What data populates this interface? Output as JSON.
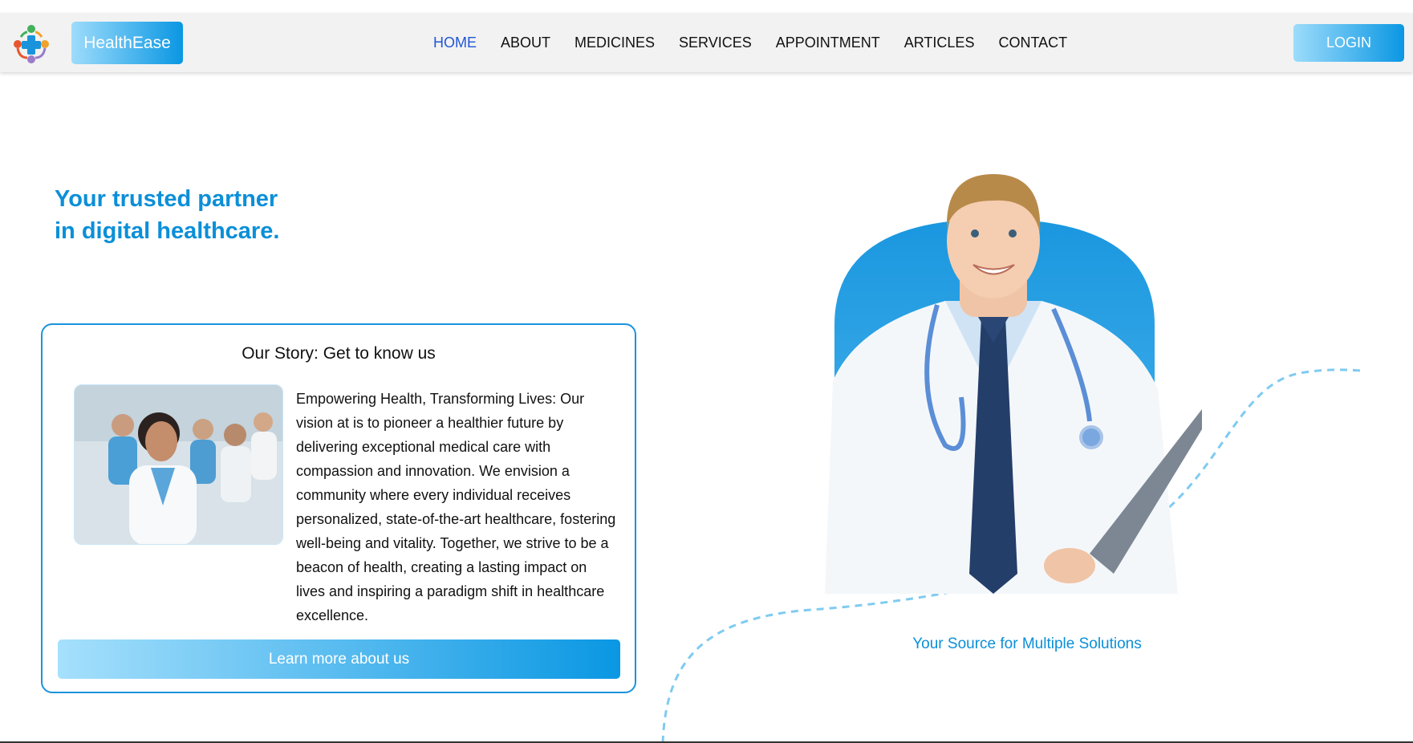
{
  "brand": {
    "name": "HealthEase",
    "logo_icon": "medical-cross-people-logo"
  },
  "nav": {
    "items": [
      {
        "label": "HOME",
        "active": true
      },
      {
        "label": "ABOUT",
        "active": false
      },
      {
        "label": "MEDICINES",
        "active": false
      },
      {
        "label": "SERVICES",
        "active": false
      },
      {
        "label": "APPOINTMENT",
        "active": false
      },
      {
        "label": "ARTICLES",
        "active": false
      },
      {
        "label": "CONTACT",
        "active": false
      }
    ],
    "login_label": "LOGIN"
  },
  "hero": {
    "line1": "Your trusted partner",
    "line2": "in digital healthcare.",
    "tagline": "Your Source for Multiple Solutions"
  },
  "story": {
    "heading": "Our Story: Get to know us",
    "body": "Empowering Health, Transforming Lives: Our vision at is to pioneer a healthier future by delivering exceptional medical care with compassion and innovation. We envision a community where every individual receives personalized, state-of-the-art healthcare, fostering well-being and vitality. Together, we strive to be a beacon of health, creating a lasting impact on lives and inspiring a paradigm shift in healthcare excellence.",
    "button_label": "Learn more about us"
  },
  "colors": {
    "accent": "#0b8fd8",
    "active_nav": "#2057d6",
    "gradient_start": "#9ddcfb",
    "gradient_end": "#0a97e3",
    "navbar_bg": "#f2f2f2"
  }
}
